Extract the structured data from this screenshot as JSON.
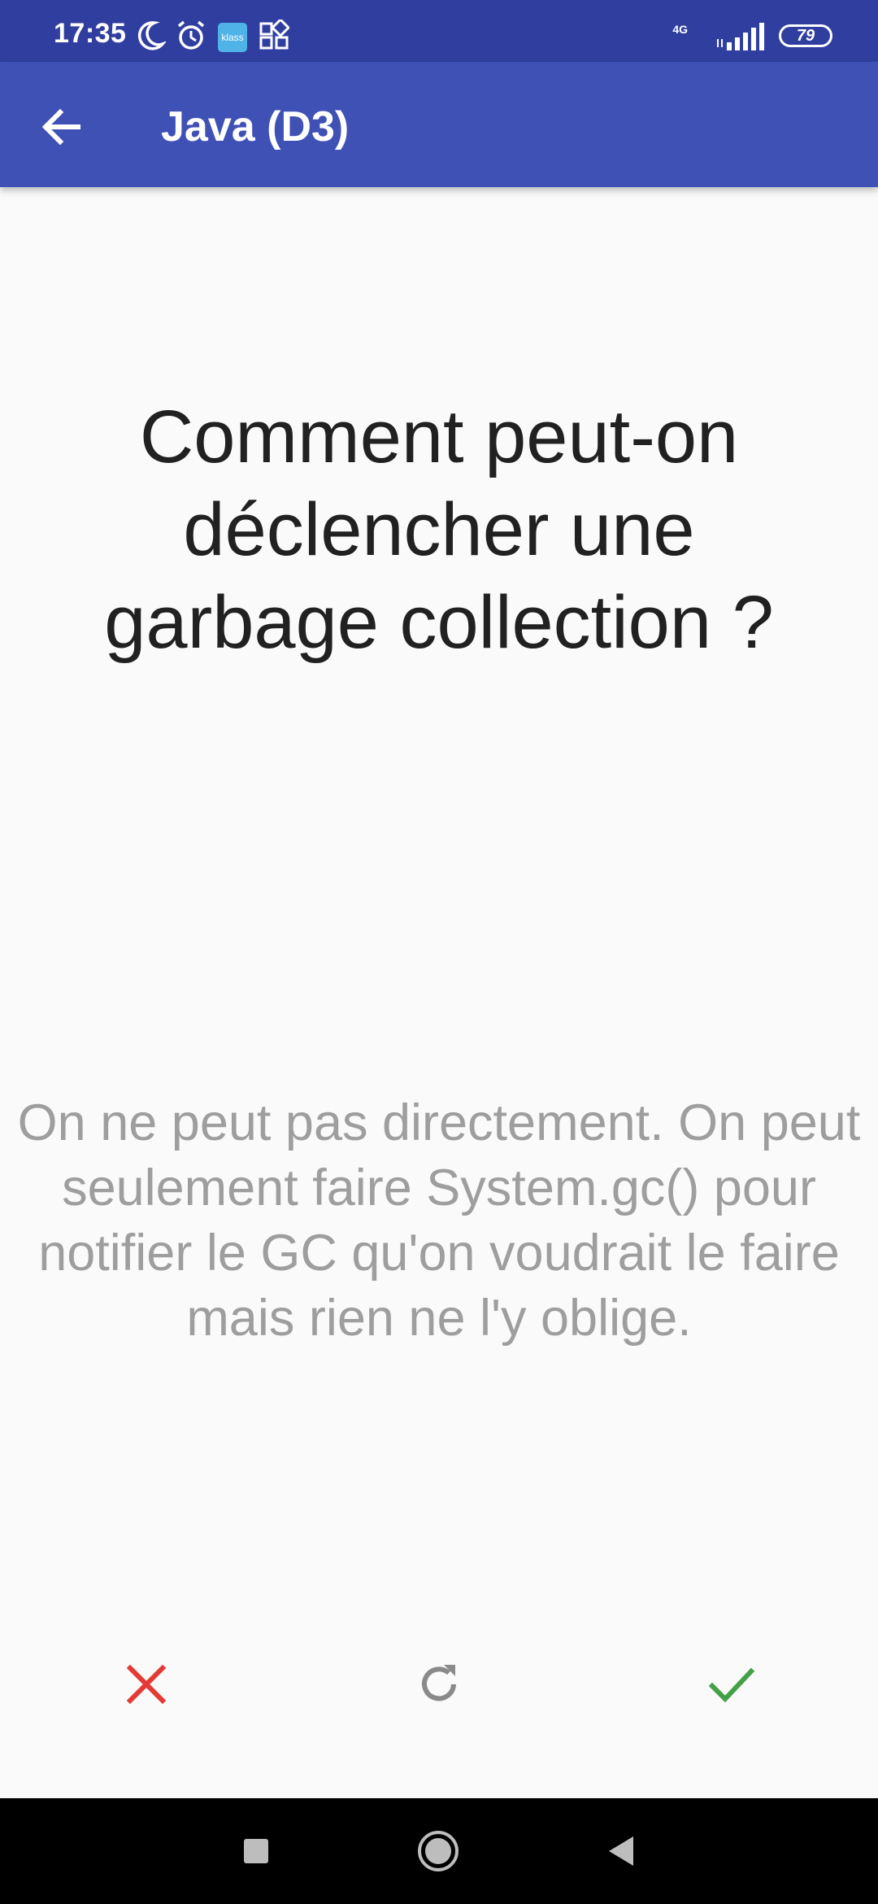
{
  "status_bar": {
    "time": "17:35",
    "klass_label": "klass",
    "network": "4G",
    "battery": "79"
  },
  "app_bar": {
    "title": "Java (D3)"
  },
  "card": {
    "question": "Comment peut-on déclencher une garbage collection ?",
    "answer": "On ne peut pas directement. On peut seulement faire System.gc() pour notifier le GC qu'on voudrait le faire mais rien ne l'y oblige."
  },
  "actions": {
    "wrong_icon": "close-icon",
    "repeat_icon": "refresh-icon",
    "right_icon": "check-icon",
    "wrong_color": "#e53935",
    "repeat_color": "#8a8a8a",
    "right_color": "#43a047"
  },
  "colors": {
    "status_bar": "#303f9f",
    "app_bar": "#3f51b5",
    "background": "#fafafa"
  }
}
